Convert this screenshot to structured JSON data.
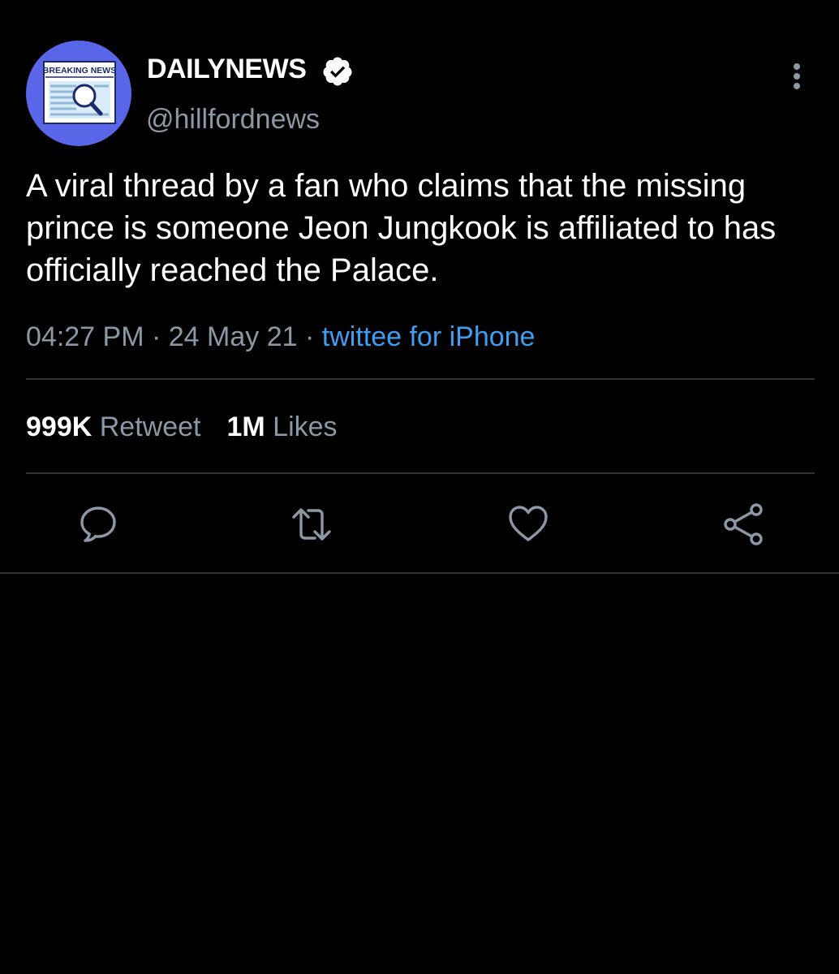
{
  "author": {
    "name": "DAILYNEWS",
    "handle": "@hillfordnews",
    "verified": true,
    "avatar_label": "BREAKING NEWS",
    "avatar_icon": "newspaper-magnifier"
  },
  "tweet": {
    "text": "A viral thread by a fan who claims that the missing prince is someone Jeon Jungkook is affiliated to has officially reached the Palace.",
    "time": "04:27 PM",
    "date": "24 May 21",
    "source": "twittee for iPhone"
  },
  "stats": {
    "retweets_count": "999K",
    "retweets_label": "Retweet",
    "likes_count": "1M",
    "likes_label": "Likes"
  },
  "actions": [
    {
      "name": "reply",
      "icon": "speech-bubble-icon"
    },
    {
      "name": "retweet",
      "icon": "retweet-icon"
    },
    {
      "name": "like",
      "icon": "heart-icon"
    },
    {
      "name": "share",
      "icon": "share-icon"
    }
  ],
  "colors": {
    "background": "#000000",
    "text": "#ffffff",
    "secondary_text": "#8b98a5",
    "link": "#3f9ef0",
    "divider": "#2f3336",
    "avatar_bg": "#5a66e8"
  }
}
